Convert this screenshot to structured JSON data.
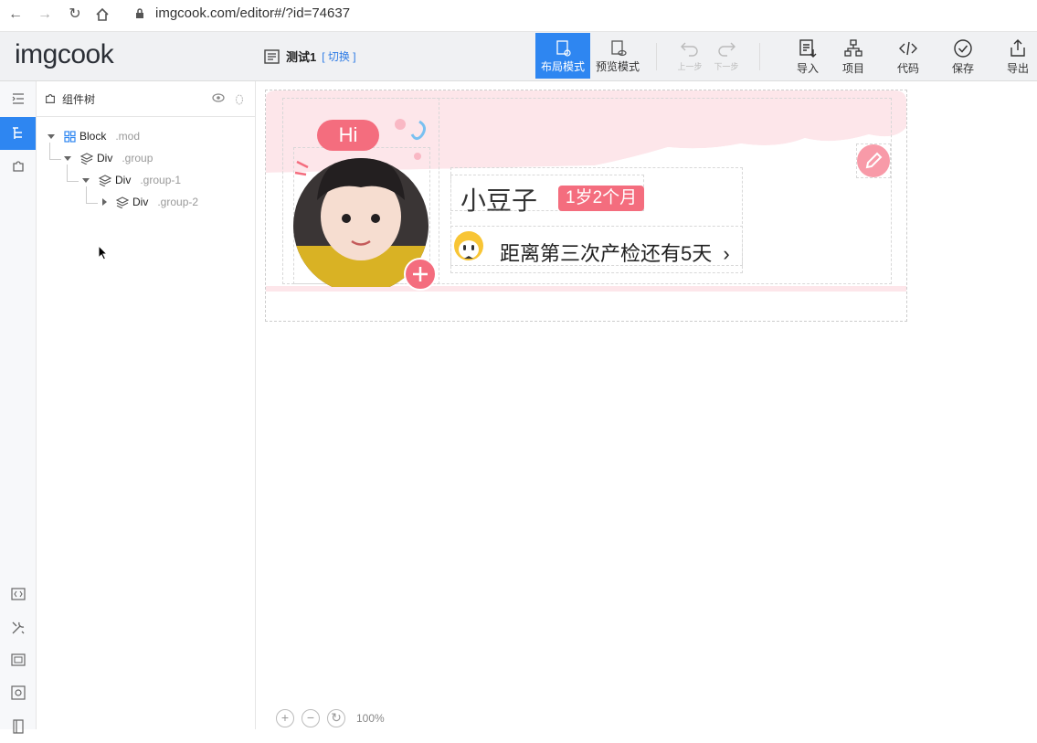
{
  "browser": {
    "url": "imgcook.com/editor#/?id=74637"
  },
  "app": {
    "logo": "imgcook",
    "doc_title": "测试1",
    "switch_label": "[ 切换 ]",
    "modes": [
      {
        "label": "布局模式"
      },
      {
        "label": "预览模式"
      }
    ],
    "undo_label": "上一步",
    "redo_label": "下一步",
    "tools": [
      {
        "label": "导入"
      },
      {
        "label": "项目"
      },
      {
        "label": "代码"
      },
      {
        "label": "保存"
      },
      {
        "label": "导出"
      }
    ]
  },
  "panel": {
    "title": "组件树",
    "tree": [
      {
        "tag": "Block",
        "cls": ".mod"
      },
      {
        "tag": "Div",
        "cls": ".group"
      },
      {
        "tag": "Div",
        "cls": ".group-1"
      },
      {
        "tag": "Div",
        "cls": ".group-2"
      }
    ]
  },
  "card": {
    "hi": "Hi",
    "name": "小豆子",
    "age": "1岁2个月",
    "reminder": "距离第三次产检还有5天"
  },
  "zoom": {
    "level": "100%"
  },
  "colors": {
    "accent": "#2e86f1",
    "pink": "#f46d7e",
    "pink_bg": "#fde6ea"
  }
}
